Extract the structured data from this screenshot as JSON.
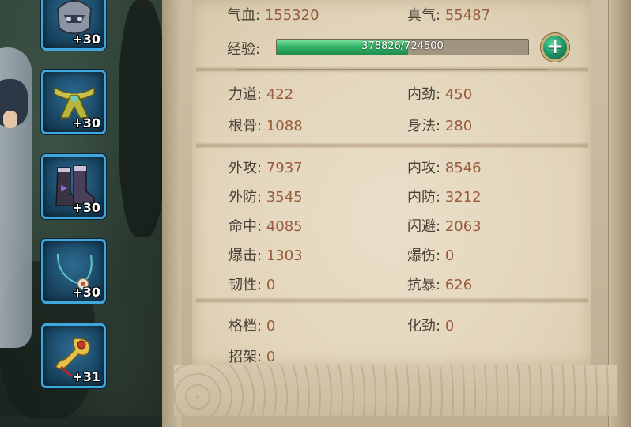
{
  "equipment": [
    {
      "icon": "helmet-icon",
      "level": "+30"
    },
    {
      "icon": "belt-icon",
      "level": "+30"
    },
    {
      "icon": "boots-icon",
      "level": "+30"
    },
    {
      "icon": "necklace-icon",
      "level": "+30"
    },
    {
      "icon": "jade-pendant-icon",
      "level": "+31"
    }
  ],
  "stats": {
    "hp": {
      "label": "气血",
      "value": "155320"
    },
    "qi": {
      "label": "真气",
      "value": "55487"
    },
    "exp": {
      "label": "经验:",
      "current": 378826,
      "max": 724500,
      "text": "378826/724500"
    },
    "strength": {
      "label": "力道",
      "value": "422"
    },
    "inner_power": {
      "label": "内劲",
      "value": "450"
    },
    "constitution": {
      "label": "根骨",
      "value": "1088"
    },
    "agility": {
      "label": "身法",
      "value": "280"
    },
    "ext_attack": {
      "label": "外攻",
      "value": "7937"
    },
    "int_attack": {
      "label": "内攻",
      "value": "8546"
    },
    "ext_defense": {
      "label": "外防",
      "value": "3545"
    },
    "int_defense": {
      "label": "内防",
      "value": "3212"
    },
    "hit": {
      "label": "命中",
      "value": "4085"
    },
    "dodge": {
      "label": "闪避",
      "value": "2063"
    },
    "crit": {
      "label": "爆击",
      "value": "1303"
    },
    "crit_damage": {
      "label": "爆伤",
      "value": "0"
    },
    "toughness": {
      "label": "韧性",
      "value": "0"
    },
    "crit_resist": {
      "label": "抗暴",
      "value": "626"
    },
    "block": {
      "label": "格档",
      "value": "0"
    },
    "dissolve": {
      "label": "化劲",
      "value": "0"
    },
    "parry": {
      "label": "招架",
      "value": "0"
    }
  },
  "separator": ":",
  "plus_label": "+",
  "colors": {
    "stat_value": "#9a5b3c",
    "slot_border": "#3fa7de",
    "exp_fill": "#36b86a"
  }
}
